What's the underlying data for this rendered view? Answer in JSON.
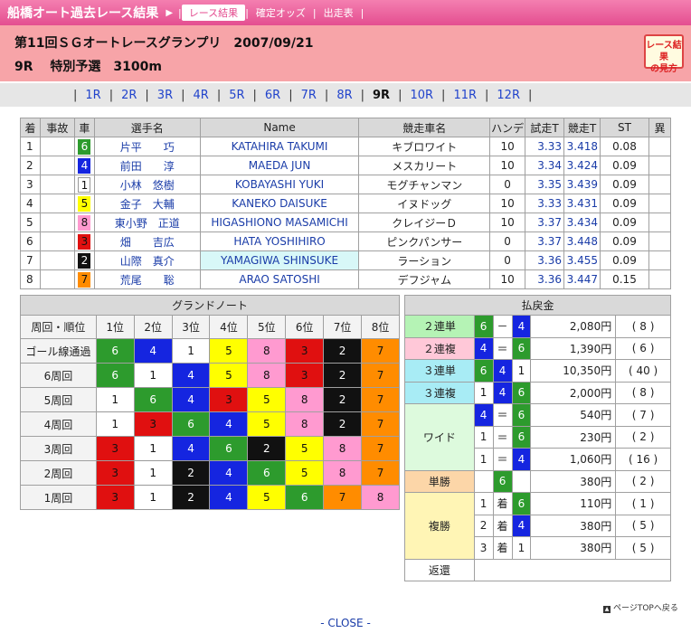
{
  "header": {
    "site_title": "船橋オート過去レース結果",
    "arrow": "▶",
    "nav": [
      "レース結果",
      "確定オッズ",
      "出走表"
    ],
    "race_line1": "第11回ＳＧオートレースグランプリ　2007/09/21",
    "race_line2": "9R　 特別予選　3100m",
    "guide_line1": "レース結果",
    "guide_line2": "の見方"
  },
  "rounds": [
    "1R",
    "2R",
    "3R",
    "4R",
    "5R",
    "6R",
    "7R",
    "8R",
    "9R",
    "10R",
    "11R",
    "12R"
  ],
  "current_round": "9R",
  "result": {
    "headers": [
      "着",
      "事故",
      "車",
      "選手名",
      "Name",
      "競走車名",
      "ハンデ",
      "試走T",
      "競走T",
      "ST",
      "異"
    ],
    "rows": [
      {
        "rank": "1",
        "accident": "",
        "car": "6",
        "jp": "片平　　巧",
        "en": "KATAHIRA TAKUMI",
        "bike": "キブロワイト",
        "handi": "10",
        "trial": "3.33",
        "race": "3.418",
        "st": "0.08",
        "ab": ""
      },
      {
        "rank": "2",
        "accident": "",
        "car": "4",
        "jp": "前田　　淳",
        "en": "MAEDA JUN",
        "bike": "メスカリート",
        "handi": "10",
        "trial": "3.34",
        "race": "3.424",
        "st": "0.09",
        "ab": ""
      },
      {
        "rank": "3",
        "accident": "",
        "car": "1",
        "jp": "小林　悠樹",
        "en": "KOBAYASHI YUKI",
        "bike": "モグチャンマン",
        "handi": "0",
        "trial": "3.35",
        "race": "3.439",
        "st": "0.09",
        "ab": ""
      },
      {
        "rank": "4",
        "accident": "",
        "car": "5",
        "jp": "金子　大輔",
        "en": "KANEKO DAISUKE",
        "bike": "イヌドッグ",
        "handi": "10",
        "trial": "3.33",
        "race": "3.431",
        "st": "0.09",
        "ab": ""
      },
      {
        "rank": "5",
        "accident": "",
        "car": "8",
        "jp": "東小野　正道",
        "en": "HIGASHIONO MASAMICHI",
        "bike": "クレイジーＤ",
        "handi": "10",
        "trial": "3.37",
        "race": "3.434",
        "st": "0.09",
        "ab": ""
      },
      {
        "rank": "6",
        "accident": "",
        "car": "3",
        "jp": "畑　　吉広",
        "en": "HATA YOSHIHIRO",
        "bike": "ピンクパンサー",
        "handi": "0",
        "trial": "3.37",
        "race": "3.448",
        "st": "0.09",
        "ab": ""
      },
      {
        "rank": "7",
        "accident": "",
        "car": "2",
        "jp": "山際　真介",
        "en": "YAMAGIWA SHINSUKE",
        "bike": "ラーション",
        "handi": "0",
        "trial": "3.36",
        "race": "3.455",
        "st": "0.09",
        "ab": ""
      },
      {
        "rank": "8",
        "accident": "",
        "car": "7",
        "jp": "荒尾　　聡",
        "en": "ARAO SATOSHI",
        "bike": "デフジャム",
        "handi": "10",
        "trial": "3.36",
        "race": "3.447",
        "st": "0.15",
        "ab": ""
      }
    ]
  },
  "grand_note": {
    "title": "グランドノート",
    "corner_label": "周回・順位",
    "positions": [
      "1位",
      "2位",
      "3位",
      "4位",
      "5位",
      "6位",
      "7位",
      "8位"
    ],
    "laps": [
      {
        "label": "ゴール線通過",
        "cars": [
          "6",
          "4",
          "1",
          "5",
          "8",
          "3",
          "2",
          "7"
        ]
      },
      {
        "label": "6周回",
        "cars": [
          "6",
          "1",
          "4",
          "5",
          "8",
          "3",
          "2",
          "7"
        ]
      },
      {
        "label": "5周回",
        "cars": [
          "1",
          "6",
          "4",
          "3",
          "5",
          "8",
          "2",
          "7"
        ]
      },
      {
        "label": "4周回",
        "cars": [
          "1",
          "3",
          "6",
          "4",
          "5",
          "8",
          "2",
          "7"
        ]
      },
      {
        "label": "3周回",
        "cars": [
          "3",
          "1",
          "4",
          "6",
          "2",
          "5",
          "8",
          "7"
        ]
      },
      {
        "label": "2周回",
        "cars": [
          "3",
          "1",
          "2",
          "4",
          "6",
          "5",
          "8",
          "7"
        ]
      },
      {
        "label": "1周回",
        "cars": [
          "3",
          "1",
          "2",
          "4",
          "5",
          "6",
          "7",
          "8"
        ]
      }
    ]
  },
  "payout": {
    "title": "払戻金",
    "nirentan": {
      "label": "２連単",
      "a": "6",
      "sep": "－",
      "b": "4",
      "amount": "2,080円",
      "pop": "( 8 )"
    },
    "nirenpuku": {
      "label": "２連複",
      "a": "4",
      "sep": "＝",
      "b": "6",
      "amount": "1,390円",
      "pop": "( 6 )"
    },
    "sanrentan": {
      "label": "３連単",
      "a": "6",
      "b": "4",
      "c": "1",
      "amount": "10,350円",
      "pop": "( 40 )"
    },
    "sanrenpuku": {
      "label": "３連複",
      "a": "1",
      "b": "4",
      "c": "6",
      "amount": "2,000円",
      "pop": "( 8 )"
    },
    "wide_label": "ワイド",
    "wide": [
      {
        "a": "4",
        "sep": "＝",
        "b": "6",
        "amount": "540円",
        "pop": "( 7 )"
      },
      {
        "a": "1",
        "sep": "＝",
        "b": "6",
        "amount": "230円",
        "pop": "( 2 )"
      },
      {
        "a": "1",
        "sep": "＝",
        "b": "4",
        "amount": "1,060円",
        "pop": "( 16 )"
      }
    ],
    "tansho": {
      "label": "単勝",
      "car": "6",
      "amount": "380円",
      "pop": "( 2 )"
    },
    "fukusho_label": "複勝",
    "fukusho": [
      {
        "rank": "1",
        "unit": "着",
        "car": "6",
        "amount": "110円",
        "pop": "( 1 )"
      },
      {
        "rank": "2",
        "unit": "着",
        "car": "4",
        "amount": "380円",
        "pop": "( 5 )"
      },
      {
        "rank": "3",
        "unit": "着",
        "car": "1",
        "amount": "380円",
        "pop": "( 5 )"
      }
    ],
    "henkan": "返還"
  },
  "footer": {
    "pagetop": "ページTOPへ戻る",
    "close": "- CLOSE -"
  }
}
